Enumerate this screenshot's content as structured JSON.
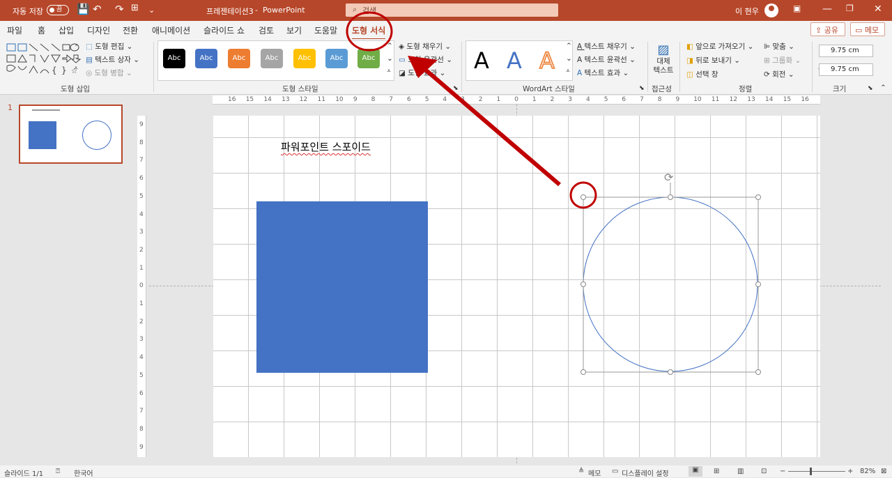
{
  "titlebar": {
    "autosave_label": "자동 저장",
    "autosave_state": "끔",
    "doc_name": "프레젠테이션3",
    "separator": "-",
    "app_name": "PowerPoint",
    "search_placeholder": "검색",
    "user_name": "이 현우",
    "qat_more": "⌄"
  },
  "menu": {
    "tabs": [
      "파일",
      "홈",
      "삽입",
      "디자인",
      "전환",
      "애니메이션",
      "슬라이드 쇼",
      "검토",
      "보기",
      "도움말",
      "도형 서식"
    ],
    "active_tab": "도형 서식",
    "share_label": "공유",
    "memo_label": "메모"
  },
  "ribbon": {
    "groups": {
      "insert_shapes": "도형 삽입",
      "shape_styles": "도형 스타일",
      "wordart_styles": "WordArt 스타일",
      "accessibility": "접근성",
      "arrange": "정렬",
      "size": "크기"
    },
    "insert_shapes_btns": {
      "edit_shape": "도형 편집",
      "text_box": "텍스트 상자",
      "merge_shapes": "도형 병합"
    },
    "style_swatches": [
      {
        "label": "Abc",
        "color": "#000000"
      },
      {
        "label": "Abc",
        "color": "#4472c4"
      },
      {
        "label": "Abc",
        "color": "#ed7d31"
      },
      {
        "label": "Abc",
        "color": "#a5a5a5"
      },
      {
        "label": "Abc",
        "color": "#ffc000"
      },
      {
        "label": "Abc",
        "color": "#5b9bd5"
      },
      {
        "label": "Abc",
        "color": "#70ad47"
      }
    ],
    "shape_fill": "도형 채우기",
    "shape_outline": "도형 윤곽선",
    "shape_effects": "도형 효과",
    "wordart_letters": [
      {
        "text": "A",
        "color": "#000000"
      },
      {
        "text": "A",
        "color": "#4472c4"
      },
      {
        "text": "A",
        "color": "#ed7d31"
      }
    ],
    "text_fill": "텍스트 채우기",
    "text_outline": "텍스트 윤곽선",
    "text_effects": "텍스트 효과",
    "alt_text": "대체 텍스트",
    "bring_forward": "앞으로 가져오기",
    "send_backward": "뒤로 보내기",
    "selection_pane": "선택 창",
    "align": "맞춤",
    "group": "그룹화",
    "rotate": "회전",
    "height": "9.75 cm",
    "width": "9.75 cm"
  },
  "thumbnails": [
    {
      "number": "1"
    }
  ],
  "ruler": {
    "h": [
      "16",
      "15",
      "14",
      "13",
      "12",
      "11",
      "10",
      "9",
      "8",
      "7",
      "6",
      "5",
      "4",
      "3",
      "2",
      "1",
      "0",
      "1",
      "2",
      "3",
      "4",
      "5",
      "6",
      "7",
      "8",
      "9",
      "10",
      "11",
      "12",
      "13",
      "14",
      "15",
      "16"
    ],
    "v": [
      "9",
      "8",
      "7",
      "6",
      "5",
      "4",
      "3",
      "2",
      "1",
      "0",
      "1",
      "2",
      "3",
      "4",
      "5",
      "6",
      "7",
      "8",
      "9"
    ]
  },
  "slide": {
    "text": "파워포인트 스포이드",
    "square_color": "#4472c4",
    "circle_stroke": "#4472c4",
    "highlight_color": "#c00000"
  },
  "statusbar": {
    "slide_info": "슬라이드 1/1",
    "language": "한국어",
    "notes": "메모",
    "display_settings": "디스플레이 설정",
    "zoom_minus": "−",
    "zoom_plus": "+",
    "zoom": "82%"
  }
}
